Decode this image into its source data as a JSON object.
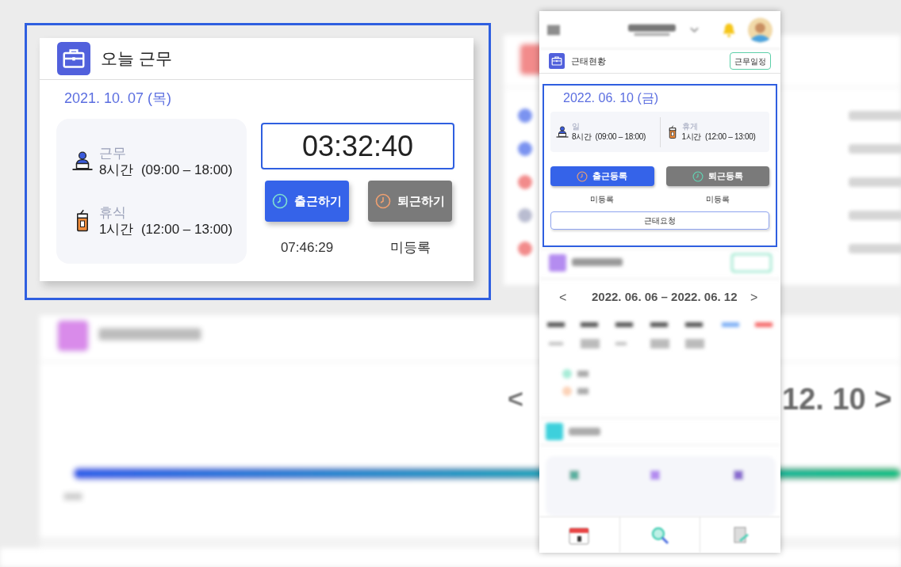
{
  "background": {
    "nav_prev": "<",
    "nav_end": "12. 10 >",
    "rows": [
      {
        "color": "#7b93f0"
      },
      {
        "color": "#7b93f0"
      },
      {
        "color": "#f28b8b"
      },
      {
        "color": "#b9bcd0"
      },
      {
        "color": "#f28b8b"
      }
    ]
  },
  "today_card": {
    "title": "오늘 근무",
    "date": "2021. 10. 07 (목)",
    "schedule": [
      {
        "kind": "work",
        "label": "근무",
        "value": "8시간  (09:00 – 18:00)"
      },
      {
        "kind": "break",
        "label": "휴식",
        "value": "1시간  (12:00 – 13:00)"
      }
    ],
    "clock": "03:32:40",
    "buttons": [
      {
        "kind": "in",
        "label": "출근하기",
        "time": "07:46:29"
      },
      {
        "kind": "out",
        "label": "퇴근하기",
        "time": "미등록"
      }
    ]
  },
  "mobile": {
    "section_title": "근태현황",
    "schedule_button": "근무일정",
    "date": "2022. 06. 10 (금)",
    "schedule": [
      {
        "kind": "work",
        "label": "일",
        "value": "8시간  (09:00 – 18:00)"
      },
      {
        "kind": "break",
        "label": "휴게",
        "value": "1시간  (12:00 – 13:00)"
      }
    ],
    "buttons": [
      {
        "kind": "in",
        "label": "출근등록",
        "time": "미등록"
      },
      {
        "kind": "out",
        "label": "퇴근등록",
        "time": "미등록"
      }
    ],
    "request_button": "근태요청",
    "week_range": "2022. 06. 06 – 2022. 06. 12",
    "prev": "<",
    "next": ">"
  }
}
